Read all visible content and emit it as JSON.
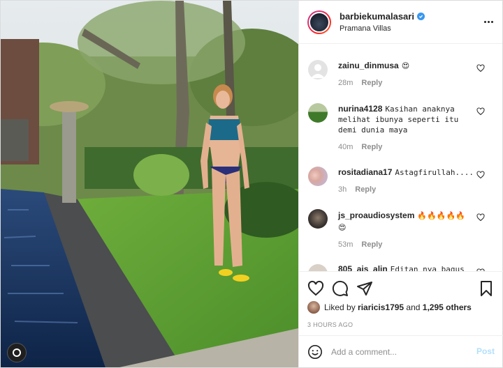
{
  "post": {
    "username": "barbiekumalasari",
    "location": "Pramana Villas",
    "verified_icon": "verified-badge-icon",
    "more_icon": "more-options-icon"
  },
  "comments": [
    {
      "username": "zainu_dinmusa",
      "text": "😍",
      "time": "28m",
      "reply": "Reply",
      "avatar": "default-avatar-icon"
    },
    {
      "username": "nurina4128",
      "text": "Kasihan anaknya melihat ibunya seperti itu demi dunia maya",
      "time": "40m",
      "reply": "Reply",
      "avatar": "landscape-avatar"
    },
    {
      "username": "rositadiana17",
      "text": "Astagfirullah....",
      "time": "3h",
      "reply": "Reply",
      "avatar": "portrait-avatar"
    },
    {
      "username": "js_proaudiosystem",
      "text": "🔥🔥🔥🔥🔥 😍",
      "time": "53m",
      "reply": "Reply",
      "avatar": "dark-avatar"
    },
    {
      "username": "805_ais_alin",
      "text": "Editan nya bagus",
      "time": "",
      "reply": "",
      "avatar": "partial-avatar"
    }
  ],
  "actions": {
    "like_icon": "heart-icon",
    "comment_icon": "comment-bubble-icon",
    "share_icon": "share-plane-icon",
    "save_icon": "bookmark-icon"
  },
  "likes": {
    "prefix": "Liked by ",
    "user": "riaricis1795",
    "middle": " and ",
    "others": "1,295 others"
  },
  "timestamp": "3 HOURS AGO",
  "add_comment": {
    "placeholder": "Add a comment...",
    "post_label": "Post"
  },
  "colors": {
    "accent": "#3897f0",
    "post_disabled": "#b2dffc",
    "meta_gray": "#8e8e8e"
  }
}
